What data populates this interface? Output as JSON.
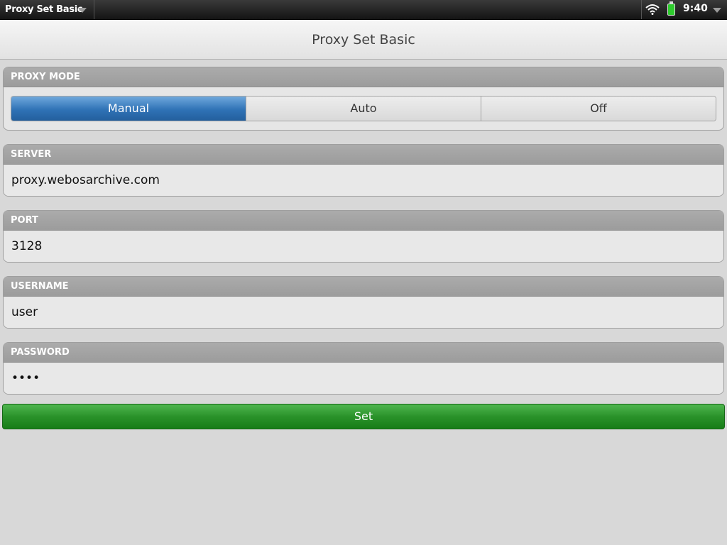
{
  "status_bar": {
    "app_name": "Proxy Set Basic",
    "time": "9:40"
  },
  "header": {
    "title": "Proxy Set Basic"
  },
  "proxy_mode": {
    "label": "PROXY MODE",
    "options": [
      "Manual",
      "Auto",
      "Off"
    ],
    "selected": "Manual"
  },
  "server": {
    "label": "SERVER",
    "value": "proxy.webosarchive.com"
  },
  "port": {
    "label": "PORT",
    "value": "3128"
  },
  "username": {
    "label": "USERNAME",
    "value": "user"
  },
  "password": {
    "label": "PASSWORD",
    "value": "••••"
  },
  "set_button": {
    "label": "Set"
  },
  "colors": {
    "accent": "#2f72b6",
    "set_button": "#2a922a",
    "background": "#d8d8d8"
  }
}
